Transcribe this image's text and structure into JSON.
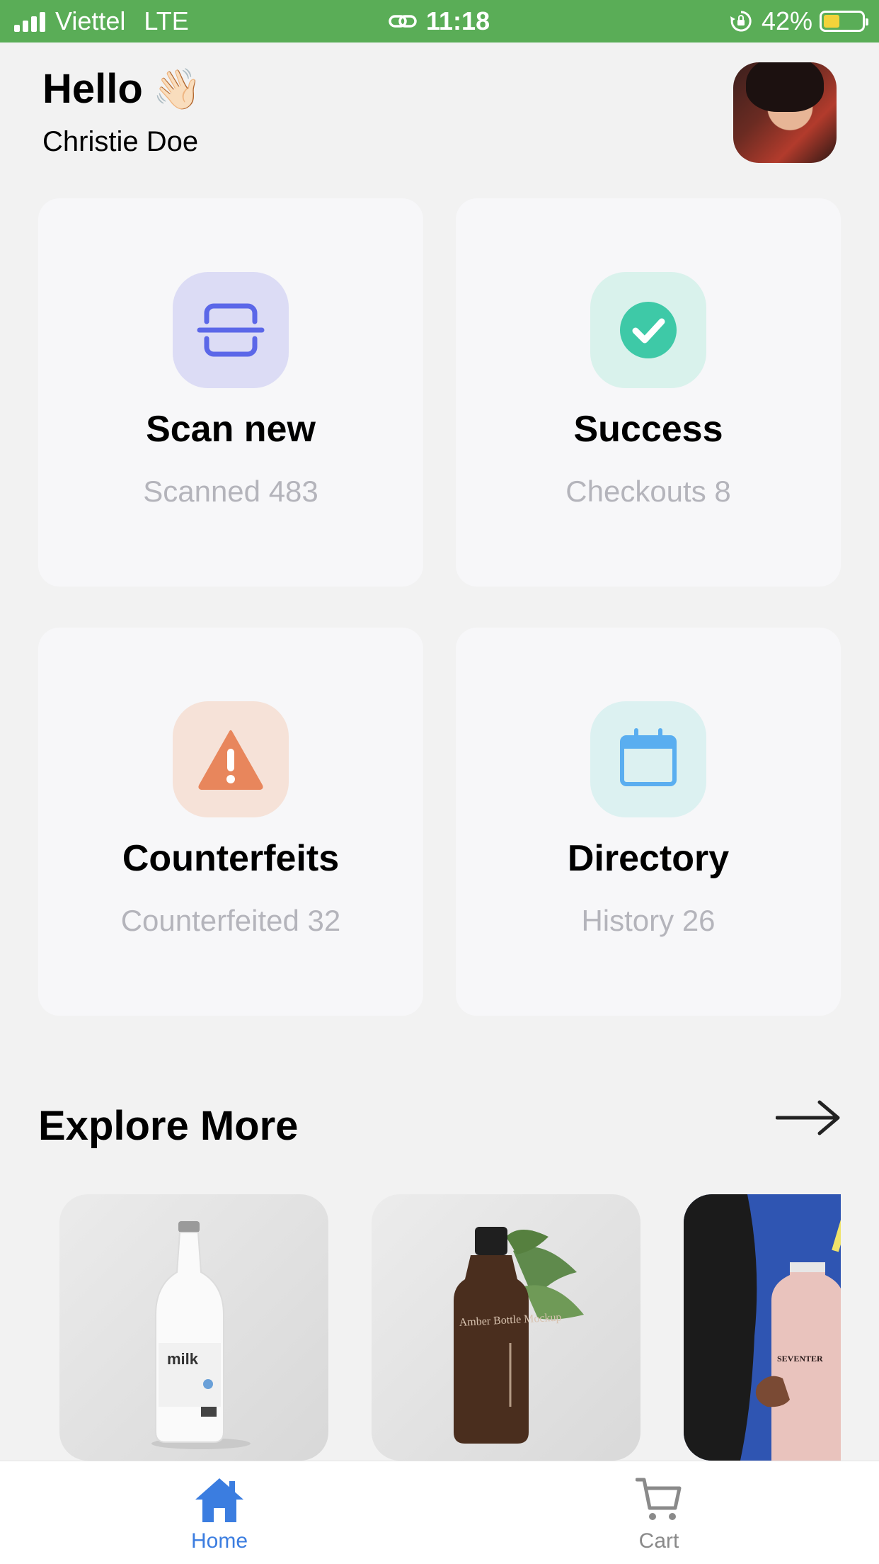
{
  "status_bar": {
    "carrier": "Viettel",
    "network": "LTE",
    "time": "11:18",
    "battery": "42%",
    "battery_level": 0.42,
    "icons": [
      "signal-icon",
      "link-icon",
      "rotation-lock-icon",
      "battery-icon"
    ]
  },
  "header": {
    "greeting": "Hello",
    "greeting_emoji": "👋🏻",
    "user_name": "Christie Doe"
  },
  "cards": [
    {
      "title": "Scan new",
      "subtitle": "Scanned 483",
      "icon": "scan-icon",
      "icon_bg": "#dcdcf5",
      "icon_color": "#5b67e8"
    },
    {
      "title": "Success",
      "subtitle": "Checkouts 8",
      "icon": "check-circle-icon",
      "icon_bg": "#d9f2ec",
      "icon_color": "#3ec9a7"
    },
    {
      "title": "Counterfeits",
      "subtitle": "Counterfeited 32",
      "icon": "warning-icon",
      "icon_bg": "#f6e2d8",
      "icon_color": "#e8865c"
    },
    {
      "title": "Directory",
      "subtitle": "History 26",
      "icon": "calendar-icon",
      "icon_bg": "#dcf1f1",
      "icon_color": "#5aaef0"
    }
  ],
  "explore": {
    "title": "Explore More",
    "arrow_icon": "arrow-right-icon",
    "products": [
      {
        "name": "milk-bottle-image",
        "label": "milk"
      },
      {
        "name": "amber-bottle-image",
        "label": "Amber Bottle Mockup"
      },
      {
        "name": "pink-milk-bottle-image",
        "label": "SEVENTER"
      }
    ]
  },
  "tabbar": {
    "home_label": "Home",
    "cart_label": "Cart",
    "active": "Home",
    "active_color": "#3b7de0",
    "inactive_color": "#8a8a8a"
  }
}
